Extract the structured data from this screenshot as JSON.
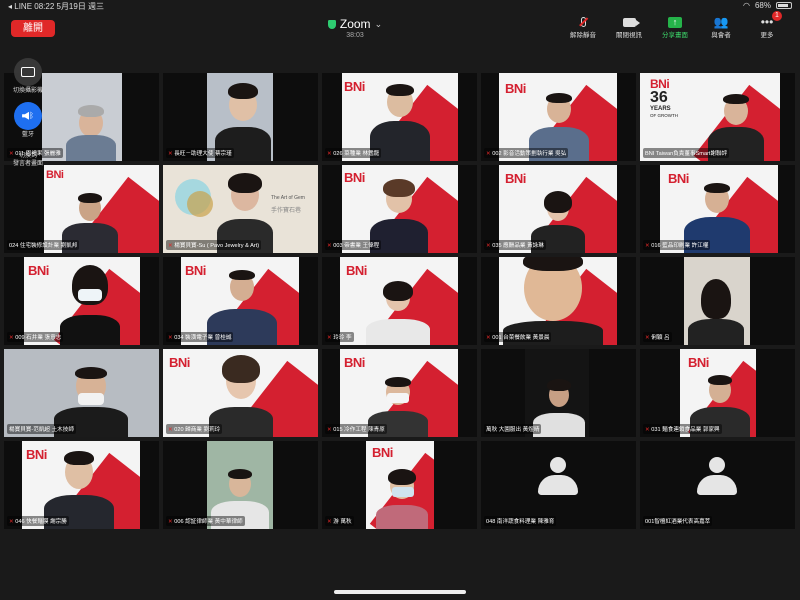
{
  "status_bar": {
    "left": "◂ LINE   08:22   5月19日 週三",
    "battery": "68%"
  },
  "header": {
    "leave_label": "離開",
    "app_title": "Zoom",
    "timer": "38:03"
  },
  "toolbar": {
    "unmute_label": "解除靜音",
    "stop_video_label": "關閉視訊",
    "share_label": "分享畫面",
    "participants_label": "與會者",
    "more_label": "更多",
    "participants_badge": "1"
  },
  "side_panel": {
    "switch_camera_label": "切換攝影機",
    "bluetooth_label": "藍牙",
    "switch_view_label": "切換到\n發言者畫面"
  },
  "brand": {
    "bni_text": "BNi",
    "bni_years_big": "36",
    "bni_years_word": "YEARS",
    "bni_years_sub": "OF GROWTH",
    "pavo_line1": "The Art of Gem",
    "pavo_line2": "手作寶石巷"
  },
  "participants": [
    {
      "name": "011 恩禮果 張麗雅",
      "muted": true
    },
    {
      "name": "長旺－助理大使 蔡宗瑾",
      "muted": true
    },
    {
      "name": "026 菜種業 林鑑龍",
      "muted": true
    },
    {
      "name": "002 影音活動策劃執行業 吳弘",
      "muted": true
    },
    {
      "name": "BNI Taiwan負責董事Smart謝聯評",
      "muted": false
    },
    {
      "name": "024 住宅裝修設計業 劉凱邦",
      "muted": false
    },
    {
      "name": "楊寶貝寶-Su ( Pavo Jewelry & Art)",
      "muted": true
    },
    {
      "name": "003 帝書業 王偉程",
      "muted": true
    },
    {
      "name": "035 應酬品業 黃詠琳",
      "muted": true
    },
    {
      "name": "016 藍品印刷業 許江權",
      "muted": true
    },
    {
      "name": "009 石井業 張意志",
      "muted": true
    },
    {
      "name": "034 裝潢電子業 曾桂誠",
      "muted": true
    },
    {
      "name": "玲玲 李",
      "muted": true
    },
    {
      "name": "001 台菜餐飲業 黃景晨",
      "muted": true
    },
    {
      "name": "俐穎 呂",
      "muted": true
    },
    {
      "name": "楊寶貝寶-范凱超 土木技師",
      "muted": false
    },
    {
      "name": "020 歸商業 劉莉玲",
      "muted": true
    },
    {
      "name": "015 冷作工程 陳青原",
      "muted": true
    },
    {
      "name": "萬秋 大園服出 黃煜晴",
      "muted": false
    },
    {
      "name": "031 麵食連鎖食品業 郭家興",
      "muted": true
    },
    {
      "name": "046 快餐麵膜 謝宗勝",
      "muted": true
    },
    {
      "name": "006 認証律師業 黃中華律師",
      "muted": true
    },
    {
      "name": "游 萬秋",
      "muted": true
    },
    {
      "name": "048 南洋蔬食料理業 陳雅育",
      "muted": false
    },
    {
      "name": "001智檀紅酒業代表高嘉萃",
      "muted": false
    }
  ]
}
